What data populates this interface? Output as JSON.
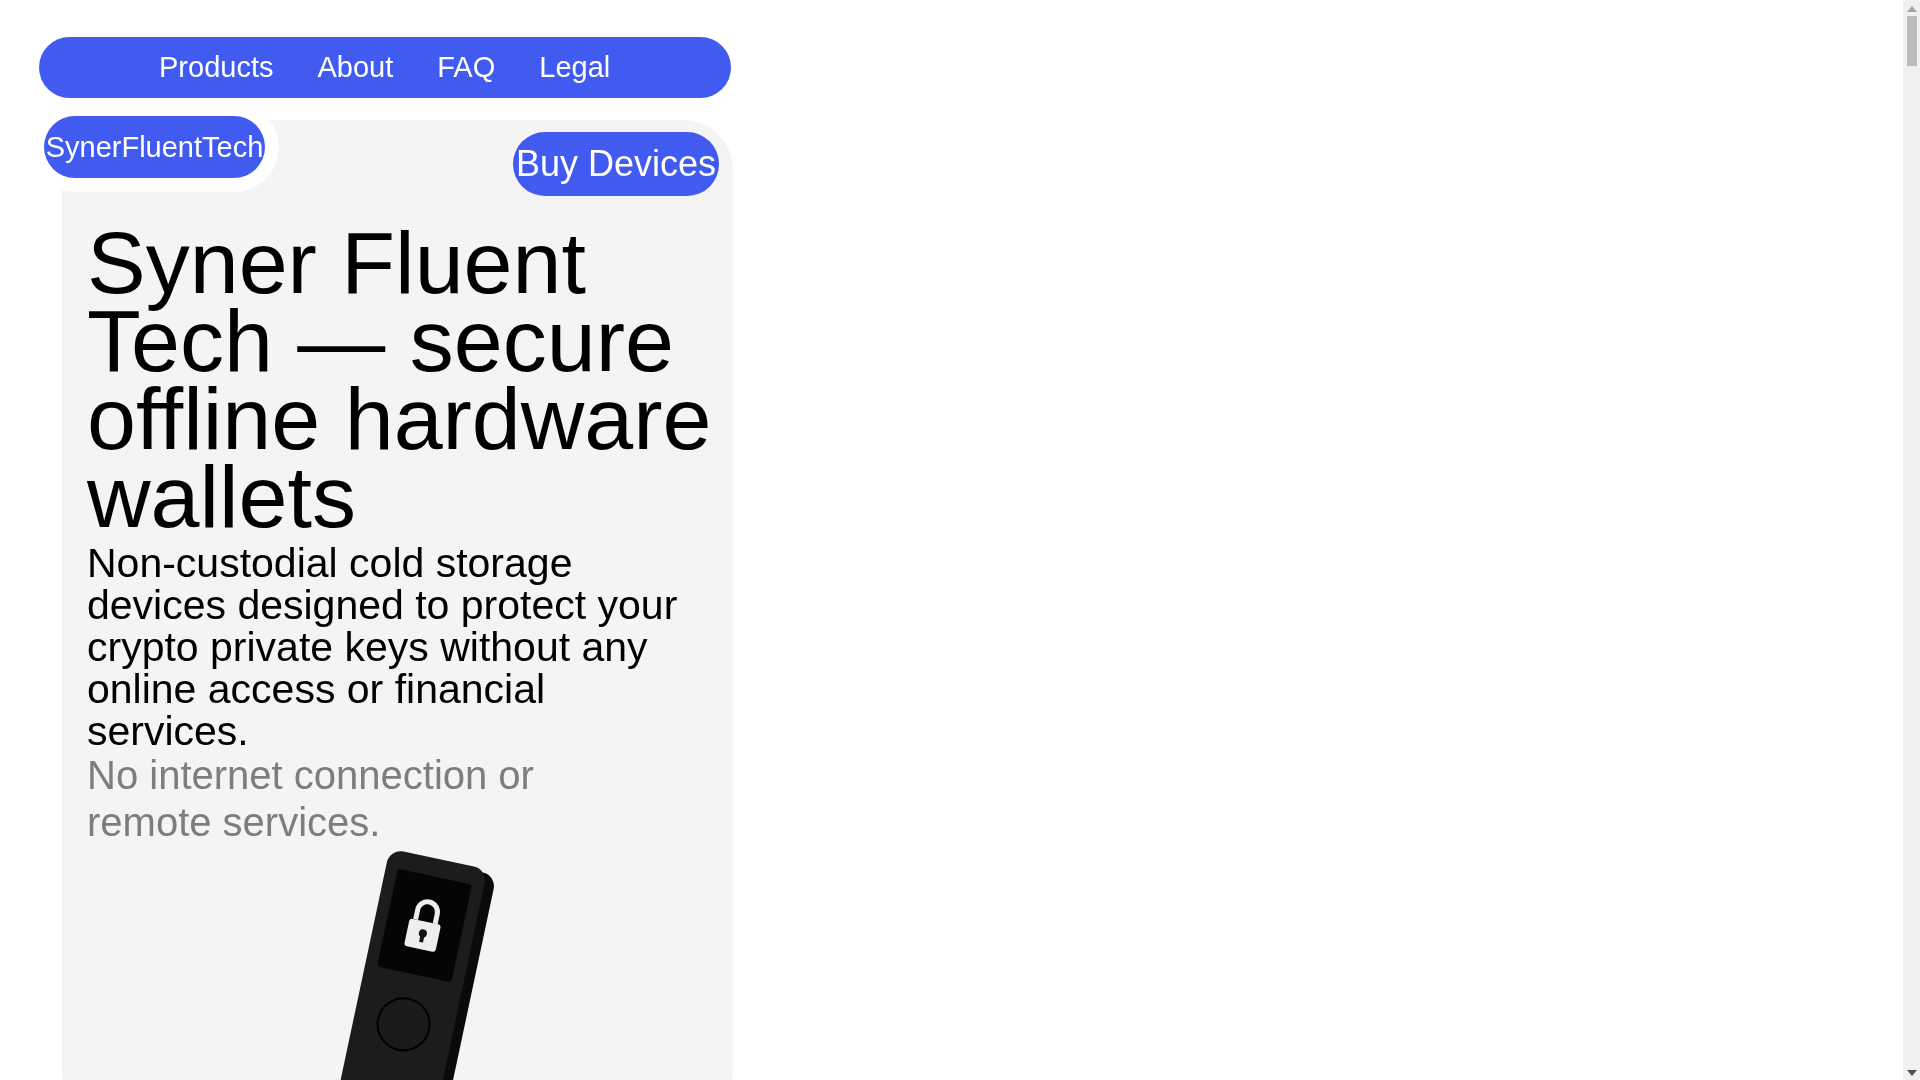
{
  "nav": {
    "links": [
      "Products",
      "About",
      "FAQ",
      "Legal"
    ]
  },
  "logo": "SynerFluentTech",
  "buy_button": "Buy Devices",
  "hero": {
    "headline": "Syner Fluent Tech — secure offline hardware wallets",
    "description": "Non-custodial cold storage devices designed to protect your crypto private keys without any online access or financial services.",
    "note": "No internet connection or remote services."
  }
}
